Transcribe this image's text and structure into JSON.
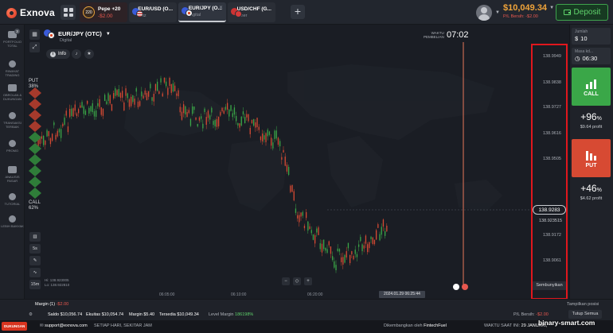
{
  "brand": {
    "name": "Exnova"
  },
  "tabs": [
    {
      "title": "Pepe +20",
      "sub": "-$2.00",
      "badge": "220"
    },
    {
      "title": "EUR/USD (O...",
      "sub": "Blitz"
    },
    {
      "title": "EUR/JPY (O...",
      "sub": "Digital"
    },
    {
      "title": "USD/CHF (G...",
      "sub": "Biner"
    }
  ],
  "account": {
    "balance": "$10,049.34",
    "pl": "P/L Bersih: -$2.00",
    "deposit_label": "Deposit"
  },
  "sidebar": [
    {
      "label": "PORTFOLIO TOTAL",
      "badge": "3"
    },
    {
      "label": "RIWAYAT TRADING"
    },
    {
      "label": "OBROLAN & DUKUNGAN"
    },
    {
      "label": "TRANSAKSI TERBAIK"
    },
    {
      "label": "PROMO"
    },
    {
      "label": "ANALISIS PASAR"
    },
    {
      "label": "TUTORIAL"
    },
    {
      "label": "LEBIH BANYAK"
    }
  ],
  "asset": {
    "name": "EUR/JPY (OTC)",
    "type": "Digital",
    "info_label": "Info"
  },
  "purchase": {
    "label_line1": "WAKTU",
    "label_line2": "PEMBELIAN",
    "time": "07:02"
  },
  "sentiment": {
    "put_label": "PUT",
    "put_pct": "38%",
    "call_label": "CALL",
    "call_pct": "62%"
  },
  "price_scale": {
    "ticks": [
      "138.9949",
      "138.9838",
      "138.9727",
      "138.9616",
      "138.9505",
      "138.9172",
      "138.9061"
    ],
    "current": "138.9283",
    "current2": "138.923515",
    "hide_label": "Sembunyikan"
  },
  "timeframes": [
    "5s",
    "15m"
  ],
  "hl": {
    "high": "Hi: 138.923005",
    "low": "Lo: 138.922810"
  },
  "time_axis": {
    "ticks": [
      "06:05:00",
      "06:10:00",
      "06:20:00"
    ],
    "cursor": "2024.01.29 06:25:44"
  },
  "right": {
    "amount_label": "Jumlah",
    "amount_value": "10",
    "expiry_label": "Masa kd...",
    "expiry_value": "06:30",
    "call_label": "CALL",
    "call_pct": "+96",
    "call_profit": "$9.64 profit",
    "put_label": "PUT",
    "put_pct": "+46",
    "put_profit": "$4.62 profit"
  },
  "bottom": {
    "margin_label": "Margin (1)",
    "margin_pl": "-$2.00",
    "show_positions": "Tampilkan posisi",
    "saldo": "Saldo $10,056.74",
    "ekuitas": "Ekuitas $10,054.74",
    "margin": "Margin $5.40",
    "tersedia": "Tersedia $10,049.34",
    "level_margin_label": "Level Margin",
    "level_margin": "186198%",
    "pl_label": "P/L Bersih:",
    "pl_value": "-$2.00",
    "close_all": "Tutup Semua"
  },
  "status": {
    "support_badge": "DUKUNGAN",
    "email": "support@exnova.com",
    "hours": "SETIAP HARI, SEKITAR JAM",
    "developed": "Dikembangkan oleh",
    "dev_name": "FintechFuel",
    "time_label": "WAKTU SAAT INI:",
    "date": "29 JANUARI,"
  },
  "watermark": "binary-smart.com",
  "colors": {
    "up": "#3aa748",
    "down": "#d74a33",
    "accent": "#f0a43a",
    "highlight": "#e0171d"
  }
}
